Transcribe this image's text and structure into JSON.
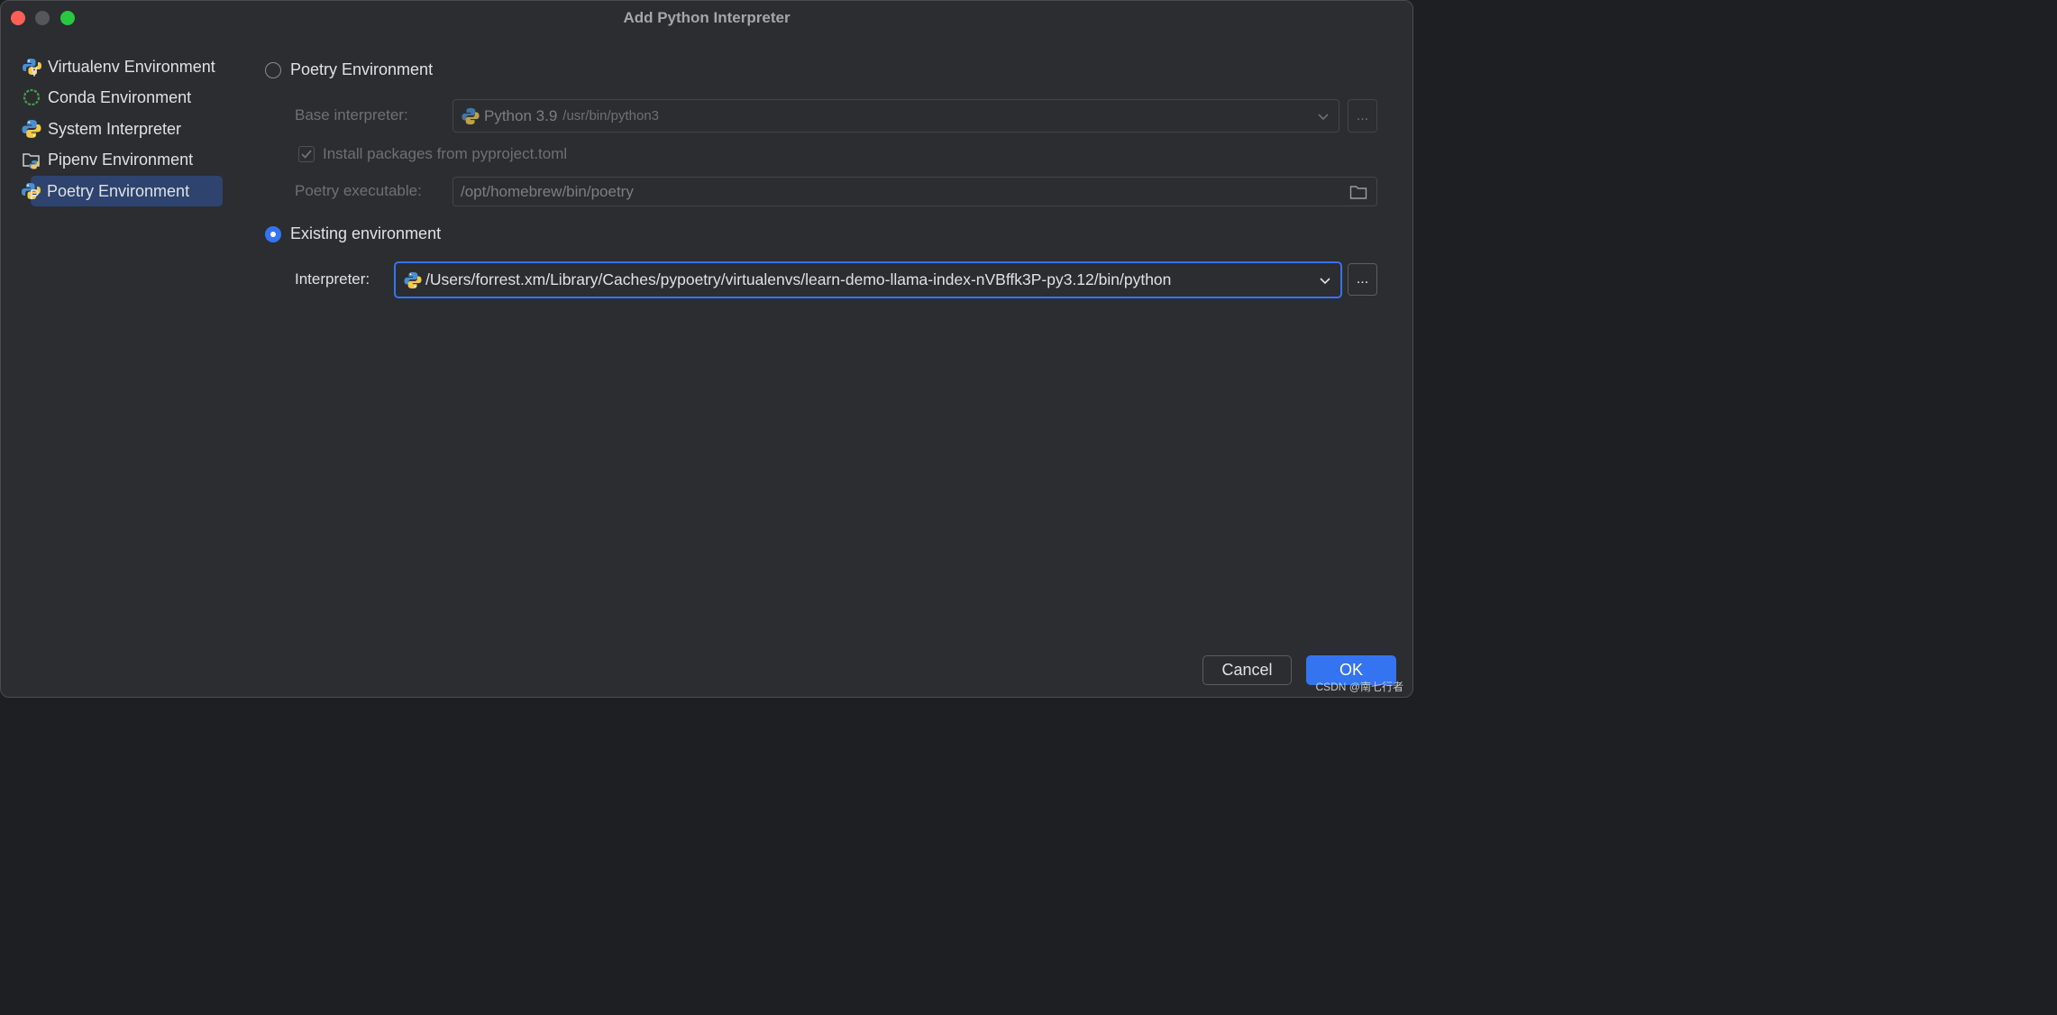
{
  "window": {
    "title": "Add Python Interpreter"
  },
  "sidebar": {
    "items": [
      {
        "label": "Virtualenv Environment",
        "icon": "virtualenv-icon"
      },
      {
        "label": "Conda Environment",
        "icon": "conda-icon"
      },
      {
        "label": "System Interpreter",
        "icon": "python-icon"
      },
      {
        "label": "Pipenv Environment",
        "icon": "pipenv-folder-icon"
      },
      {
        "label": "Poetry Environment",
        "icon": "poetry-icon",
        "selected": true
      }
    ]
  },
  "new_env": {
    "radio_label": "Poetry Environment",
    "selected": false,
    "base_interpreter_label": "Base interpreter:",
    "base_interpreter_name": "Python 3.9",
    "base_interpreter_path": "/usr/bin/python3",
    "install_checkbox_label": "Install packages from pyproject.toml",
    "install_checked": true,
    "executable_label": "Poetry executable:",
    "executable_value": "/opt/homebrew/bin/poetry",
    "browse_button": "..."
  },
  "existing_env": {
    "radio_label": "Existing environment",
    "selected": true,
    "interpreter_label": "Interpreter:",
    "interpreter_value": "/Users/forrest.xm/Library/Caches/pypoetry/virtualenvs/learn-demo-llama-index-nVBffk3P-py3.12/bin/python",
    "browse_button": "..."
  },
  "buttons": {
    "cancel": "Cancel",
    "ok": "OK"
  },
  "watermark": "CSDN @南七行者",
  "colors": {
    "accent": "#3574f0",
    "background": "#2b2d30",
    "selection": "#2e436e"
  }
}
